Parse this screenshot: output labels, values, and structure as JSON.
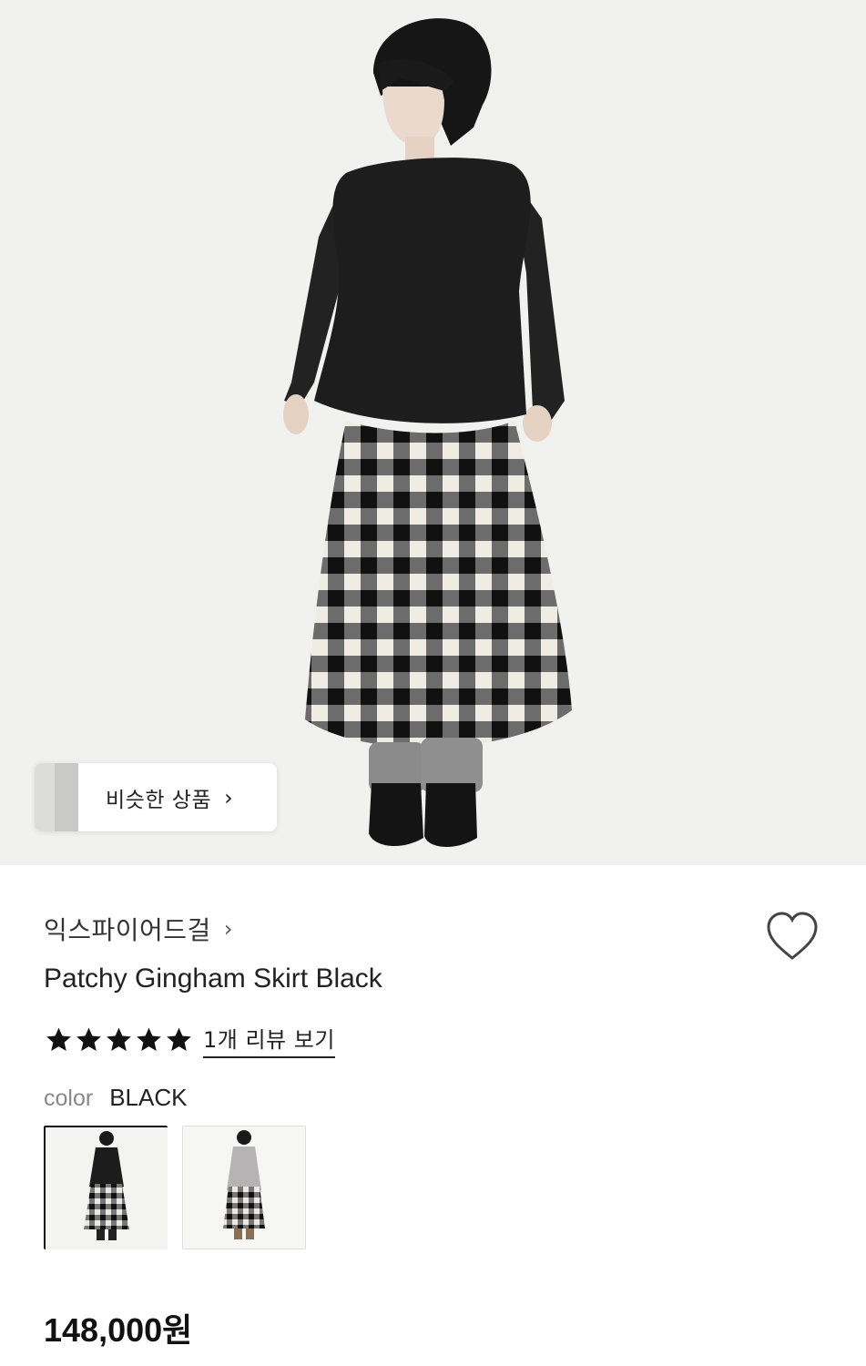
{
  "similar_products": {
    "label": "비슷한 상품",
    "chevron": "›"
  },
  "product": {
    "brand": "익스파이어드걸",
    "brand_chevron": "›",
    "title": "Patchy Gingham Skirt Black",
    "rating_stars": 5,
    "review_link": "1개 리뷰 보기",
    "color_label": "color",
    "color_value": "BLACK",
    "swatches": [
      {
        "name": "black",
        "selected": true
      },
      {
        "name": "gray",
        "selected": false
      }
    ],
    "price": "148,000원"
  },
  "icons": {
    "wishlist": "heart-outline-icon",
    "star": "star-filled-icon",
    "chevron": "chevron-right-icon"
  },
  "colors": {
    "text_primary": "#111111",
    "text_muted": "#888888",
    "selected_border": "#111111"
  }
}
